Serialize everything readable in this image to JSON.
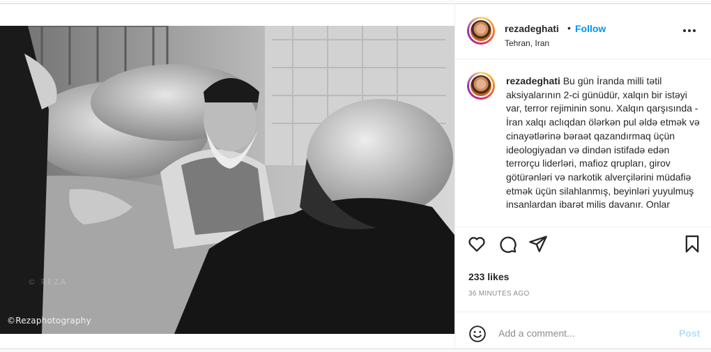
{
  "post": {
    "username": "rezadeghati",
    "separator": "•",
    "follow_label": "Follow",
    "location": "Tehran, Iran",
    "more_icon": "more-horizontal-icon",
    "photo": {
      "credit": "©Rezaphotography",
      "watermark": "© REZA"
    },
    "caption": {
      "username": "rezadeghati",
      "text": "Bu gün İranda milli tətil aksiyalarının 2-ci günüdür, xalqın bir istəyi var, terror rejiminin sonu. Xalqın qarşısında - İran xalqı aclıqdan ölərkən pul əldə etmək və cinayətlərinə bəraət qazandırmaq üçün ideologiyadan və dindən istifadə edən terrorçu liderləri, mafioz qrupları, girov götürənləri və narkotik alverçilərini müdafiə etmək üçün silahlanmış, beyinləri yuyulmuş insanlardan ibarət milis davanır. Onlar"
    },
    "actions": {
      "like_icon": "heart-icon",
      "comment_icon": "comment-icon",
      "share_icon": "paper-plane-icon",
      "save_icon": "bookmark-icon"
    },
    "likes": "233 likes",
    "timestamp": "36 MINUTES AGO",
    "comment": {
      "emoji_icon": "emoji-icon",
      "placeholder": "Add a comment...",
      "post_label": "Post"
    }
  }
}
